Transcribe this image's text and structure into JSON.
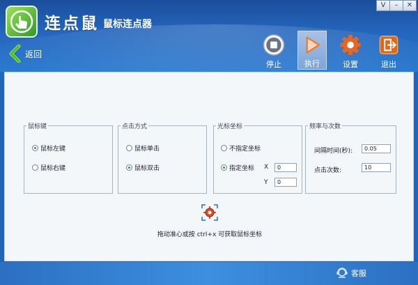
{
  "window": {
    "title": "连点鼠",
    "subtitle": "鼠标连点器",
    "controls": {
      "menu": "V",
      "minimize": "–",
      "close": "✕"
    }
  },
  "nav": {
    "back_label": "返回",
    "back_icon": "chevron-left-icon"
  },
  "toolbar": {
    "stop": {
      "label": "停止",
      "icon": "stop-icon"
    },
    "run": {
      "label": "执行",
      "icon": "play-icon",
      "active": true
    },
    "settings": {
      "label": "设置",
      "icon": "gear-icon"
    },
    "exit": {
      "label": "退出",
      "icon": "exit-icon"
    }
  },
  "groups": {
    "mouse_button": {
      "title": "鼠标键",
      "left": "鼠标左键",
      "right": "鼠标右键",
      "selected": "left"
    },
    "click_mode": {
      "title": "点击方式",
      "single": "鼠标单击",
      "double": "鼠标双击",
      "selected": "double"
    },
    "cursor_pos": {
      "title": "光标坐标",
      "unspecified": "不指定坐标",
      "specified": "指定坐标",
      "selected": "specified",
      "x_label": "X",
      "y_label": "Y",
      "x_value": "0",
      "y_value": "0"
    },
    "frequency": {
      "title": "频率与次数",
      "interval_label": "间隔时间(秒):",
      "interval_value": "0.05",
      "count_label": "点击次数:",
      "count_value": "10"
    }
  },
  "hint": "拖动准心或按 ctrl+x 可获取鼠标坐标",
  "footer": {
    "service_label": "客服",
    "service_icon": "support-icon"
  },
  "colors": {
    "header_blue": "#2466bd",
    "accent_green": "#1d9d35",
    "stop_gray": "#6a7482",
    "run_orange": "#f07a2a",
    "settings_orange": "#e9661e",
    "exit_orange": "#dd6a1c"
  }
}
